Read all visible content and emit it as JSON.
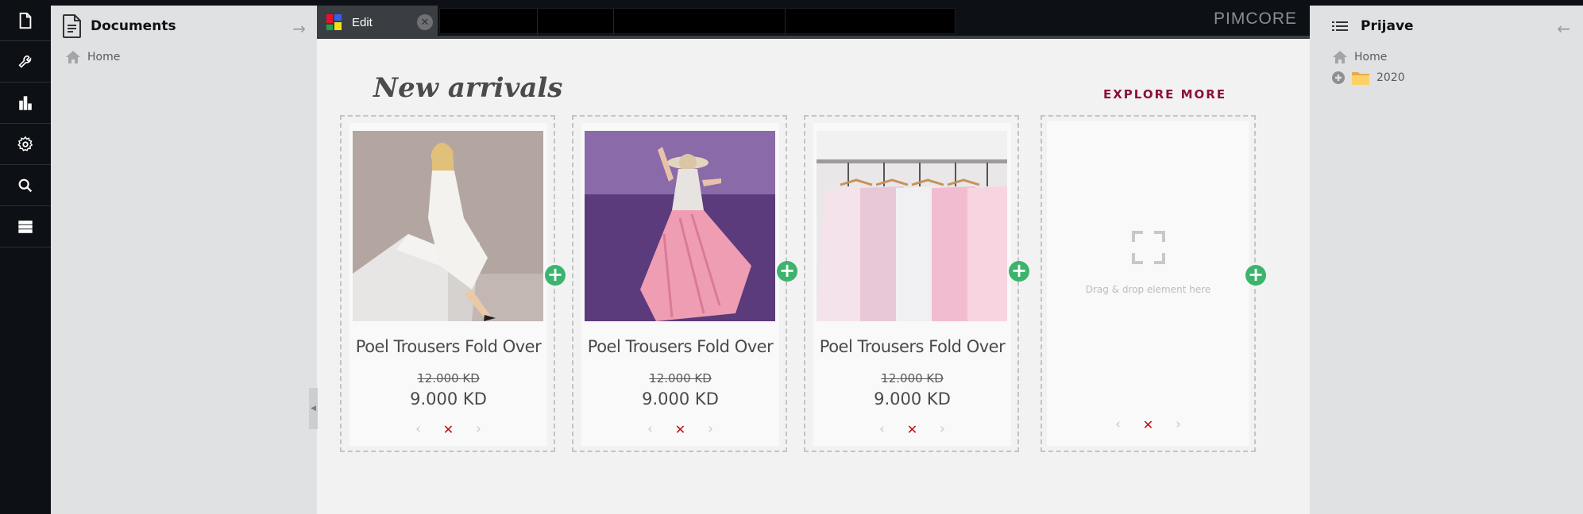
{
  "rail": {
    "items": [
      {
        "name": "documents",
        "icon": "document-icon"
      },
      {
        "name": "tools",
        "icon": "wrench-icon"
      },
      {
        "name": "marketing",
        "icon": "bar-chart-icon"
      },
      {
        "name": "settings",
        "icon": "gear-icon"
      },
      {
        "name": "search",
        "icon": "search-icon"
      },
      {
        "name": "data-objects",
        "icon": "server-list-icon"
      }
    ]
  },
  "left_panel": {
    "title": "Documents",
    "tree": [
      {
        "label": "Home",
        "icon": "home-icon"
      }
    ]
  },
  "topbar": {
    "tabs": [
      {
        "label": "Edit",
        "icon": "pimcore-edit-icon",
        "active": true
      }
    ],
    "brand": "PIMCORE"
  },
  "main": {
    "heading": "New arrivals",
    "explore_label": "EXPLORE MORE",
    "accent_color": "#8c0f3c",
    "add_button_color": "#3cb46e",
    "products": [
      {
        "name": "Poel Trousers Fold Over",
        "old_price": "12.000 KD",
        "price": "9.000 KD",
        "image": "woman-white-dress"
      },
      {
        "name": "Poel Trousers Fold Over",
        "old_price": "12.000 KD",
        "price": "9.000 KD",
        "image": "woman-lavender-field"
      },
      {
        "name": "Poel Trousers Fold Over",
        "old_price": "12.000 KD",
        "price": "9.000 KD",
        "image": "clothes-rack"
      }
    ],
    "drop_zone": {
      "text": "Drag & drop element here"
    },
    "controls": {
      "prev": "‹",
      "delete": "✕",
      "next": "›"
    }
  },
  "right_panel": {
    "title": "Prijave",
    "tree": [
      {
        "label": "Home",
        "icon": "home-icon"
      },
      {
        "label": "2020",
        "icon": "folder-icon",
        "expandable": true
      }
    ]
  }
}
